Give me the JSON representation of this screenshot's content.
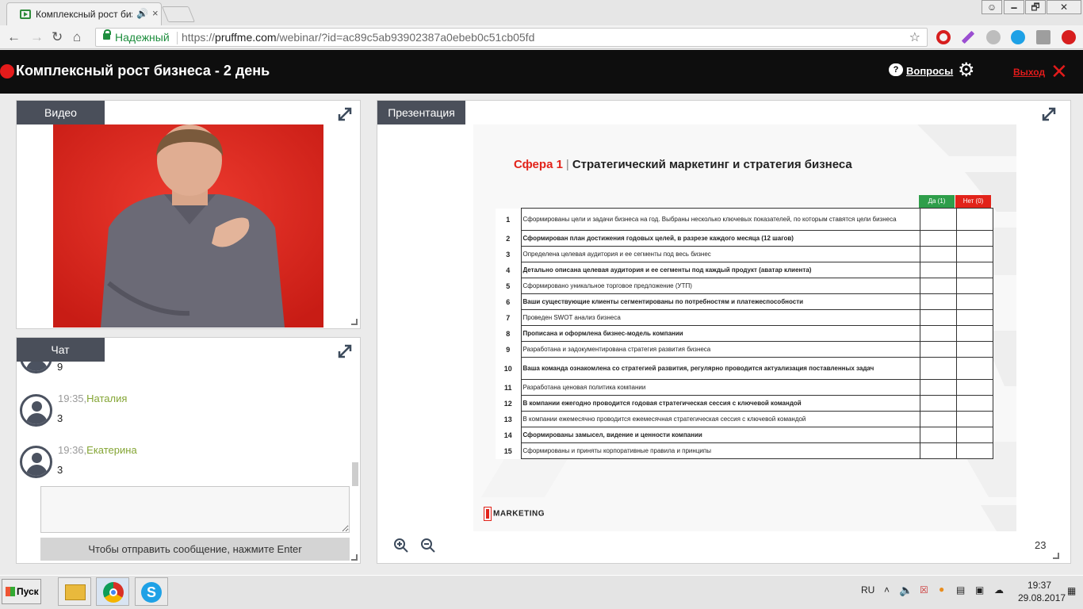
{
  "browser": {
    "tab_title": "Комплексный рост биз",
    "tab_close": "×",
    "tab_speaker": "🔊",
    "secure_label": "Надежный",
    "url_scheme": "https://",
    "url_host": "pruffme.com",
    "url_path": "/webinar/?id=ac89c5ab93902387a0ebeb0c51cb05fd",
    "window_controls": [
      "🗕",
      "🗗",
      "✕"
    ]
  },
  "app": {
    "title": "Комплексный рост бизнеса - 2 день",
    "questions_label": "Вопросы",
    "exit_label": "Выход"
  },
  "video_panel": {
    "tab_label": "Видео"
  },
  "chat_panel": {
    "tab_label": "Чат",
    "messages": [
      {
        "time": "",
        "name": "",
        "text": "9"
      },
      {
        "time": "19:35,",
        "name": "Наталия",
        "text": "3"
      },
      {
        "time": "19:36,",
        "name": "Екатерина",
        "text": "3"
      }
    ],
    "send_hint": "Чтобы отправить сообщение, нажмите Enter"
  },
  "presentation_panel": {
    "tab_label": "Презентация",
    "page_number": "23",
    "slide": {
      "sphere": "Сфера 1",
      "separator": "|",
      "heading": "Стратегический маркетинг и стратегия бизнеса",
      "col_yes": "Да (1)",
      "col_no": "Нет (0)",
      "rows": [
        {
          "n": "1",
          "text": "Сформированы цели и задачи бизнеса на год. Выбраны несколько ключевых показателей, по которым ставятся цели бизнеса",
          "bold": false
        },
        {
          "n": "2",
          "text": "Сформирован план достижения годовых целей, в разрезе каждого месяца (12 шагов)",
          "bold": true
        },
        {
          "n": "3",
          "text": "Определена целевая аудитория и ее сегменты под весь бизнес",
          "bold": false
        },
        {
          "n": "4",
          "text": "Детально описана целевая аудитория и ее сегменты под каждый продукт (аватар клиента)",
          "bold": true
        },
        {
          "n": "5",
          "text": "Сформировано уникальное торговое предложение (УТП)",
          "bold": false
        },
        {
          "n": "6",
          "text": "Ваши существующие клиенты сегментированы по потребностям и платежеспособности",
          "bold": true
        },
        {
          "n": "7",
          "text": "Проведен SWOT анализ бизнеса",
          "bold": false
        },
        {
          "n": "8",
          "text": "Прописана и оформлена бизнес-модель компании",
          "bold": true
        },
        {
          "n": "9",
          "text": "Разработана и задокументирована стратегия развития бизнеса",
          "bold": false
        },
        {
          "n": "10",
          "text": "Ваша команда ознакомлена со стратегией развития, регулярно проводится актуализация поставленных задач",
          "bold": true
        },
        {
          "n": "11",
          "text": "Разработана ценовая политика компании",
          "bold": false
        },
        {
          "n": "12",
          "text": "В компании ежегодно проводится годовая стратегическая сессия с ключевой командой",
          "bold": true
        },
        {
          "n": "13",
          "text": "В компании ежемесячно проводится ежемесячная стратегическая сессия с ключевой командой",
          "bold": false
        },
        {
          "n": "14",
          "text": "Сформированы замысел, видение и ценности компании",
          "bold": true
        },
        {
          "n": "15",
          "text": "Сформированы и приняты корпоративные правила и принципы",
          "bold": false
        }
      ],
      "logo_text": "MARKETING"
    }
  },
  "taskbar": {
    "start_label": "Пуск",
    "language": "RU",
    "time": "19:37",
    "date": "29.08.2017"
  },
  "colors": {
    "accent_red": "#e2231a",
    "accent_green": "#2e9e4a",
    "header_bg": "#0e0e0e",
    "panel_tab_bg": "#4a4f5a"
  }
}
